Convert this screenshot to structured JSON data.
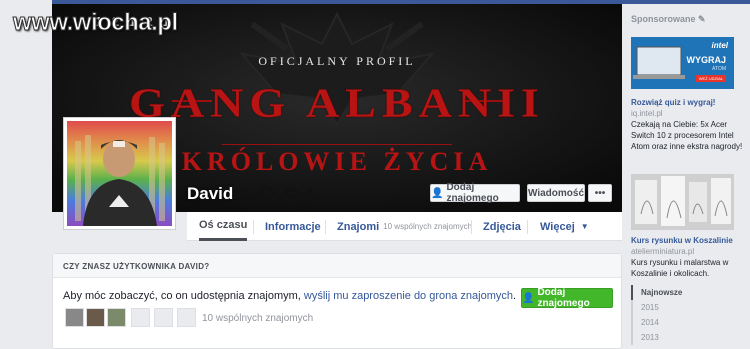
{
  "watermark": {
    "text": "www.wiocha.pl",
    "digits": "1 2  1 2 1"
  },
  "cover": {
    "kicker": "OFICJALNY PROFIL",
    "title": "GANG ALBANII",
    "subtitle": "KRÓLOWIE ŻYCIA"
  },
  "profile": {
    "name": "David",
    "add_friend": "Dodaj znajomego",
    "message": "Wiadomość",
    "more": "•••"
  },
  "nav": {
    "tabs": [
      {
        "label": "Oś czasu"
      },
      {
        "label": "Informacje"
      },
      {
        "label": "Znajomi",
        "sub": "10 wspólnych znajomych"
      },
      {
        "label": "Zdjęcia"
      },
      {
        "label": "Więcej"
      }
    ]
  },
  "card": {
    "header": "CZY ZNASZ UŻYTKOWNIKA DAVID?",
    "text_before": "Aby móc zobaczyć, co on udostępnia znajomym, ",
    "link": "wyślij mu zaproszenie do grona znajomych",
    "text_after": ".",
    "add_button": "Dodaj znajomego",
    "mutual": "10 wspólnych znajomych"
  },
  "sidebar": {
    "sponsored": "Sponsorowane",
    "ad1": {
      "banner_heading": "WYGRAJ",
      "banner_sub": "ATOM",
      "banner_cta": "WEŹ UDZIAŁ",
      "brand": "intel",
      "title": "Rozwiąż quiz i wygraj!",
      "url": "iq.intel.pl",
      "body": "Czekają na Ciebie: 5x Acer Switch 10 z procesorem Intel Atom oraz inne ekstra nagrody!"
    },
    "ad2": {
      "title": "Kurs rysunku w Koszalinie",
      "url": "atelierminiatura.pl",
      "body": "Kurs rysunku i malarstwa w Koszalinie i okolicach."
    },
    "years": [
      "Najnowsze",
      "2015",
      "2014",
      "2013"
    ]
  },
  "colors": {
    "fb_blue": "#3b5998",
    "link": "#365899",
    "green": "#42b72a",
    "cover_red": "#b81414"
  }
}
